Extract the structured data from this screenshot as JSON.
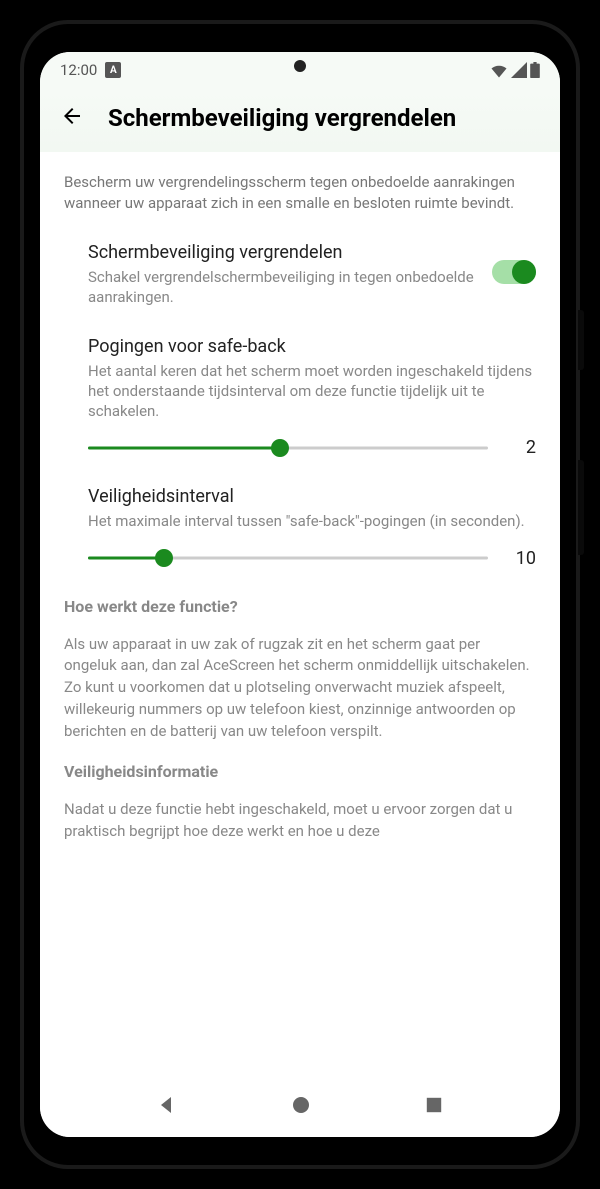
{
  "status_bar": {
    "time": "12:00",
    "badge": "A"
  },
  "app_bar": {
    "title": "Schermbeveiliging vergrendelen"
  },
  "intro": "Bescherm uw vergrendelingsscherm tegen onbedoelde aanrakingen wanneer uw apparaat zich in een smalle en besloten ruimte bevindt.",
  "settings": {
    "lock": {
      "title": "Schermbeveiliging vergrendelen",
      "desc": "Schakel vergrendelschermbeveiliging in tegen onbedoelde aanrakingen.",
      "enabled": true
    },
    "attempts": {
      "title": "Pogingen voor safe-back",
      "desc": "Het aantal keren dat het scherm moet worden ingeschakeld tijdens het onderstaande tijdsinterval om deze functie tijdelijk uit te schakelen.",
      "value": "2",
      "fill_percent": 48
    },
    "interval": {
      "title": "Veiligheidsinterval",
      "desc": "Het maximale interval tussen \"safe-back\"-pogingen (in seconden).",
      "value": "10",
      "fill_percent": 19
    }
  },
  "help": {
    "heading1": "Hoe werkt deze functie?",
    "body1": "Als uw apparaat in uw zak of rugzak zit en het scherm gaat per ongeluk aan, dan zal AceScreen het scherm onmiddellijk uitschakelen. Zo kunt u voorkomen dat u plotseling onverwacht muziek afspeelt, willekeurig nummers op uw telefoon kiest, onzinnige antwoorden op berichten en de batterij van uw telefoon verspilt.",
    "heading2": "Veiligheidsinformatie",
    "body2": "Nadat u deze functie hebt ingeschakeld, moet u ervoor zorgen dat u praktisch begrijpt hoe deze werkt en hoe u deze"
  }
}
